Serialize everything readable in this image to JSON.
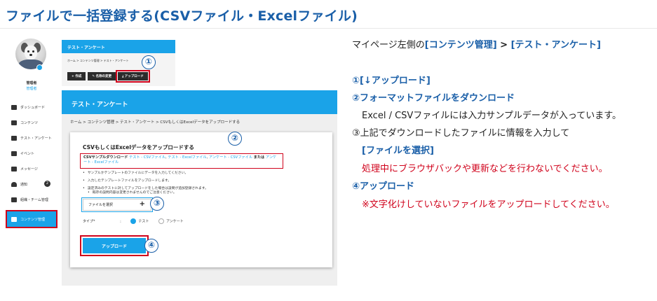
{
  "heading": "ファイルで一括登録する(CSVファイル・Excelファイル)",
  "sidebar": {
    "user_name": "管理者",
    "user_role": "管理者",
    "items": [
      {
        "label": "ダッシュボード",
        "icon": "dashboard-icon"
      },
      {
        "label": "コンテンツ",
        "icon": "content-icon"
      },
      {
        "label": "テスト・アンケート",
        "icon": "test-icon"
      },
      {
        "label": "イベント",
        "icon": "megaphone-icon"
      },
      {
        "label": "メッセージ",
        "icon": "message-icon"
      },
      {
        "label": "通知",
        "icon": "bell-icon",
        "count": "2"
      },
      {
        "label": "組織・チーム管理",
        "icon": "team-icon"
      },
      {
        "label": "コンテンツ管理",
        "icon": "folder-icon",
        "active": true
      }
    ]
  },
  "top_panel": {
    "title": "テスト・アンケート",
    "breadcrumb": "ホーム  >  コンテンツ管理  >  テスト・アンケート",
    "buttons": [
      "+ 作成",
      "✎ 名称の変更",
      "⤓ アップロード"
    ]
  },
  "main_panel": {
    "title": "テスト・アンケート",
    "breadcrumb": "ホーム  >  コンテンツ管理  >  テスト・アンケート  >  CSVもしくはExcelデータをアップロードする",
    "dialog": {
      "title": "CSVもしくはExcelデータをアップロードする",
      "sample_prefix": "CSVサンプルダウンロード",
      "link1": "テスト - CSVファイル",
      "link2": "テスト - Excelファイル",
      "link3": "アンケート - CSVファイル",
      "sample_mid": "または",
      "link4": "アンケート - Excelファイル",
      "bullet1": "サンプルかテンプレートのファイルにデータを入力してください。",
      "bullet2": "入力したテンプレートファイルをアップロードします。",
      "bullet3a": "設定済みのテストに対してアップロードをした場合は設問が追加登録されます。",
      "bullet3b": "既存の設問内容は変更されませんのでご注意ください。",
      "file_button": "ファイルを選択",
      "type_label": "タイプ*",
      "type_sep": ":",
      "option_test": "テスト",
      "option_survey": "アンケート",
      "upload_button": "アップロード"
    }
  },
  "markers": [
    "①",
    "②",
    "③",
    "④"
  ],
  "instructions": {
    "line1_plain": "マイページ左側の",
    "line1_bold1": "[コンテンツ管理]",
    "line1_arrow": " > ",
    "line1_bold2": "[テスト・アンケート]",
    "step1": "①[↓アップロード]",
    "step2": "②フォーマットファイルをダウンロード",
    "step2_note": "Excel / CSVファイルには入力サンプルデータが入っています。",
    "step3": "③上記でダウンロードしたファイルに情報を入力して",
    "step3_action": "[ファイルを選択]",
    "step3_warning": "処理中にブラウザバックや更新などを行わないでください。",
    "step4": "④アップロード",
    "step4_warning": "※文字化けしていないファイルをアップロードしてください。"
  },
  "colors": {
    "accent": "#1aa3e8",
    "heading": "#1a5fa8",
    "highlight": "#d0021b"
  }
}
